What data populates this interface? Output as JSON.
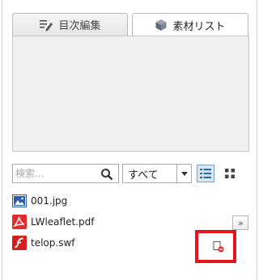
{
  "tabs": [
    {
      "label": "目次編集",
      "icon": "toc-edit-icon",
      "active": false
    },
    {
      "label": "素材リスト",
      "icon": "cube-icon",
      "active": true
    }
  ],
  "search": {
    "placeholder": "検索...",
    "value": ""
  },
  "filter": {
    "selected": "すべて"
  },
  "view": {
    "mode": "list"
  },
  "files": [
    {
      "name": "001.jpg",
      "icon": "image-file-icon",
      "color": "#2a5db0"
    },
    {
      "name": "LWleaflet.pdf",
      "icon": "pdf-file-icon",
      "color": "#e22b2b"
    },
    {
      "name": "telop.swf",
      "icon": "flash-file-icon",
      "color": "#d62020"
    }
  ],
  "expand_label": "»",
  "colors": {
    "highlight": "#e8141c",
    "list_view_active": "#dbe9f6"
  }
}
